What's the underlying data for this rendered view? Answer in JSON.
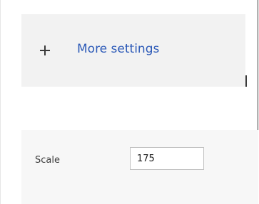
{
  "more_settings": {
    "label": "More settings",
    "icon": "plus-icon"
  },
  "scale": {
    "label": "Scale",
    "value": "175"
  },
  "colors": {
    "link_blue": "#2e5bb8",
    "panel_bg": "#f2f2f2",
    "band_bg": "#f7f7f7",
    "border": "#c2c2c2"
  }
}
